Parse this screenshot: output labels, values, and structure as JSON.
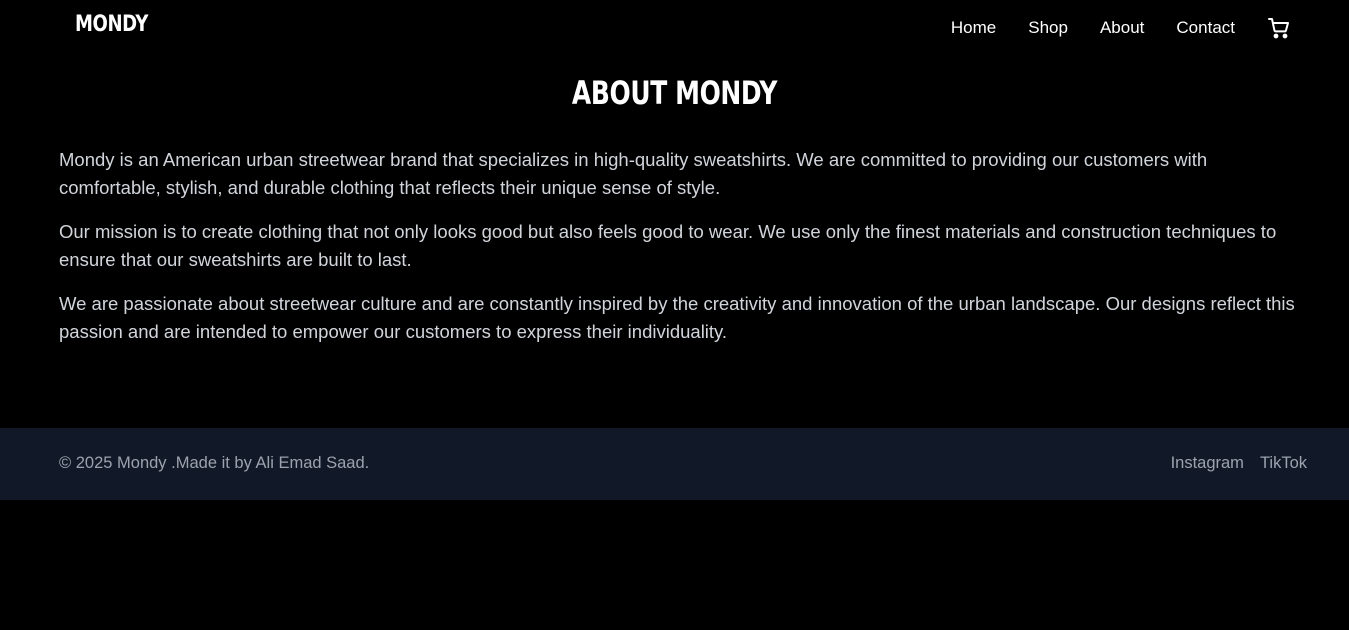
{
  "header": {
    "logo": "MONDY",
    "nav": [
      {
        "label": "Home"
      },
      {
        "label": "Shop"
      },
      {
        "label": "About"
      },
      {
        "label": "Contact"
      }
    ],
    "cart_icon": "shopping-cart-icon"
  },
  "main": {
    "title": "ABOUT MONDY",
    "paragraphs": [
      "Mondy is an American urban streetwear brand that specializes in high-quality sweatshirts. We are committed to providing our customers with comfortable, stylish, and durable clothing that reflects their unique sense of style.",
      "Our mission is to create clothing that not only looks good but also feels good to wear. We use only the finest materials and construction techniques to ensure that our sweatshirts are built to last.",
      "We are passionate about streetwear culture and are constantly inspired by the creativity and innovation of the urban landscape. Our designs reflect this passion and are intended to empower our customers to express their individuality."
    ]
  },
  "footer": {
    "copyright": "© 2025 Mondy .Made it by Ali Emad Saad.",
    "links": [
      {
        "label": "Instagram"
      },
      {
        "label": "TikTok"
      }
    ]
  },
  "colors": {
    "background": "#000000",
    "text": "#ffffff",
    "body_text": "#d1d5db",
    "footer_bg": "#111827",
    "footer_text": "#9ca3af"
  }
}
